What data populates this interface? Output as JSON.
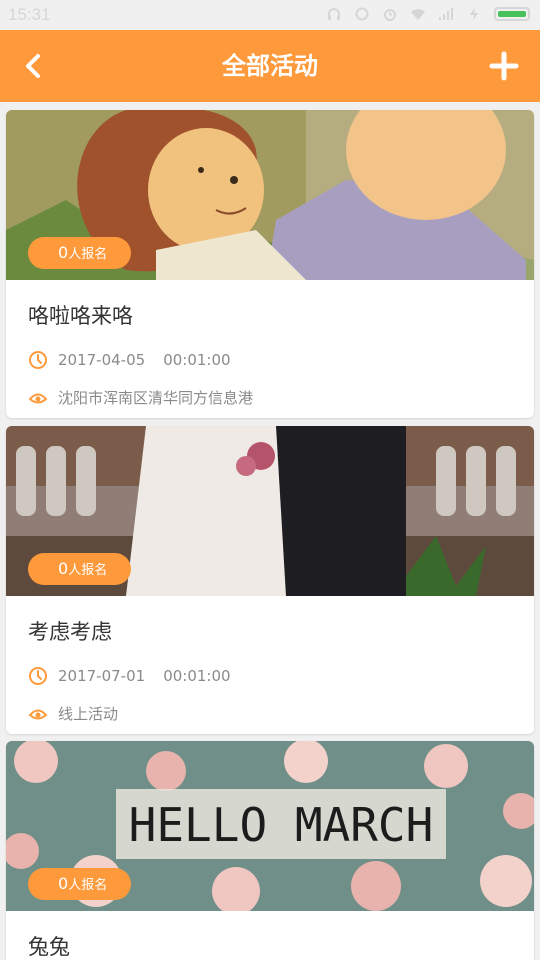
{
  "status_bar": {
    "time": "15:31"
  },
  "header": {
    "title": "全部活动"
  },
  "activities": [
    {
      "count": "0",
      "count_suffix": "人报名",
      "title": "咯啦咯来咯",
      "date": "2017-04-05",
      "time": "00:01:00",
      "location": "沈阳市浑南区清华同方信息港"
    },
    {
      "count": "0",
      "count_suffix": "人报名",
      "title": "考虑考虑",
      "date": "2017-07-01",
      "time": "00:01:00",
      "location": "线上活动"
    },
    {
      "count": "0",
      "count_suffix": "人报名",
      "title": "兔兔",
      "banner_text": "HELLO MARCH"
    }
  ],
  "colors": {
    "accent": "#ff9a3c",
    "text": "#333333",
    "meta_text": "#8a8a8a",
    "background": "#f0f0f0"
  }
}
